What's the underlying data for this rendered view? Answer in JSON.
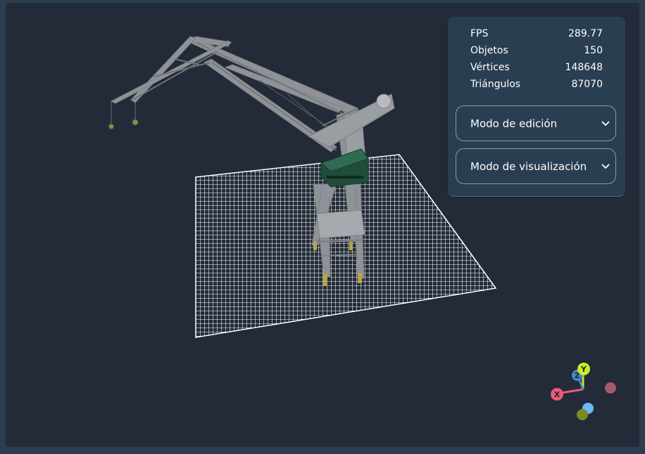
{
  "stats": [
    {
      "label": "FPS",
      "value": "289.77"
    },
    {
      "label": "Objetos",
      "value": "150"
    },
    {
      "label": "Vértices",
      "value": "148648"
    },
    {
      "label": "Triángulos",
      "value": "87070"
    }
  ],
  "menus": {
    "edit_mode": "Modo de edición",
    "view_mode": "Modo de visualización"
  },
  "gizmo": {
    "x_label": "X",
    "y_label": "Y",
    "z_label": "Z",
    "colors": {
      "x": "#f0587a",
      "y": "#c6f024",
      "z": "#4a87c8",
      "neg_x": "#a65a6c",
      "neg_y": "#7d8a1e",
      "neg_z": "#6db8f8"
    }
  },
  "colors": {
    "background": "#222b37",
    "panel": "#2a3e51",
    "grid": "#ffffff",
    "crane_body": "#8f9296",
    "cabin": "#1f4d3a"
  }
}
